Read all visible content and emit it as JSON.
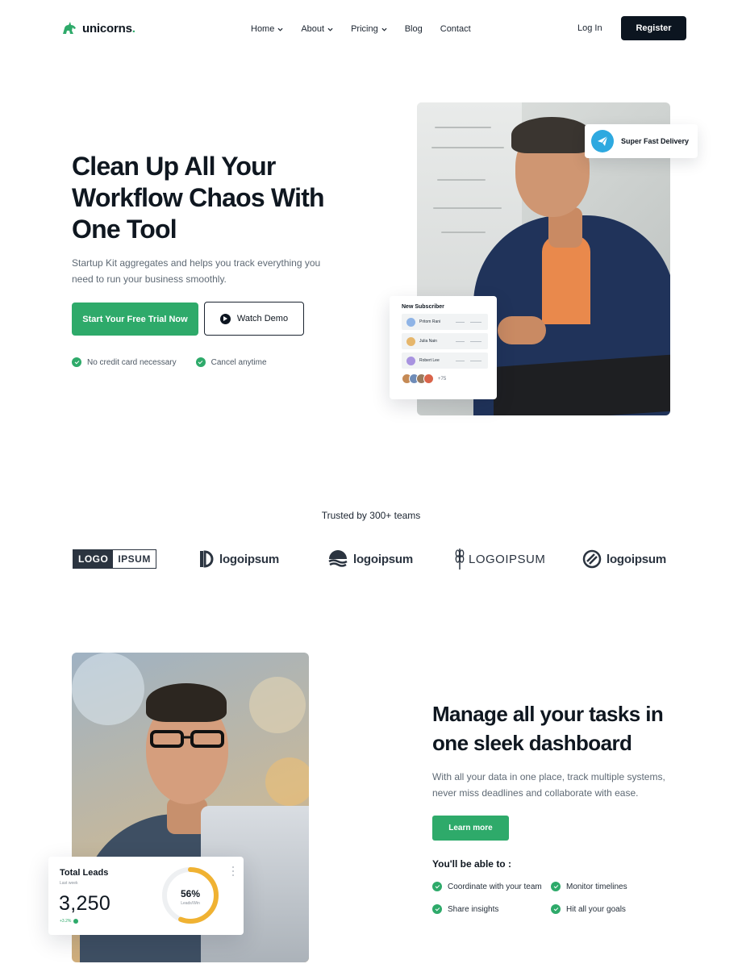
{
  "brand": {
    "name": "unicorns",
    "dot": ".",
    "accent_color": "#2eaa6a"
  },
  "nav": {
    "items": [
      {
        "label": "Home",
        "has_dropdown": true
      },
      {
        "label": "About",
        "has_dropdown": true
      },
      {
        "label": "Pricing",
        "has_dropdown": true
      },
      {
        "label": "Blog",
        "has_dropdown": false
      },
      {
        "label": "Contact",
        "has_dropdown": false
      }
    ],
    "login_label": "Log In",
    "register_label": "Register"
  },
  "hero": {
    "title": "Clean Up All Your Workflow Chaos With One Tool",
    "subtitle": "Startup Kit aggregates and helps you track everything you need to run your business smoothly.",
    "primary_cta": "Start Your Free Trial Now",
    "secondary_cta": "Watch Demo",
    "checks": [
      "No credit card necessary",
      "Cancel anytime"
    ],
    "delivery_badge": "Super Fast Delivery",
    "subscriber_card": {
      "title": "New Subscriber",
      "rows": [
        {
          "name": "Pritom Rani",
          "avatar_color": "#8fb4e6"
        },
        {
          "name": "Julia Nain",
          "avatar_color": "#e6b66b"
        },
        {
          "name": "Robert Lee",
          "avatar_color": "#a893e0"
        }
      ],
      "extra_count": "+75"
    }
  },
  "trusted": {
    "heading": "Trusted by 300+ teams",
    "logos": [
      {
        "part1": "LOGO",
        "part2": "IPSUM"
      },
      {
        "word": "logoipsum"
      },
      {
        "word": "logoipsum"
      },
      {
        "word": "LOGOIPSUM"
      },
      {
        "word": "logoipsum"
      }
    ]
  },
  "dashboard": {
    "title": "Manage all your tasks in one sleek dashboard",
    "subtitle": "With all your data in one place, track multiple systems, never miss deadlines and collaborate with ease.",
    "cta": "Learn more",
    "able_heading": "You'll be able to :",
    "features": [
      "Coordinate with your team",
      "Monitor timelines",
      "Share insights",
      "Hit all your goals"
    ],
    "leads_card": {
      "title": "Total Leads",
      "period": "Last week",
      "value": "3,250",
      "delta": "+3.2%",
      "donut_percent": 56,
      "donut_label": "56%",
      "donut_caption": "Leads/Win",
      "donut_color": "#f0b232"
    }
  }
}
